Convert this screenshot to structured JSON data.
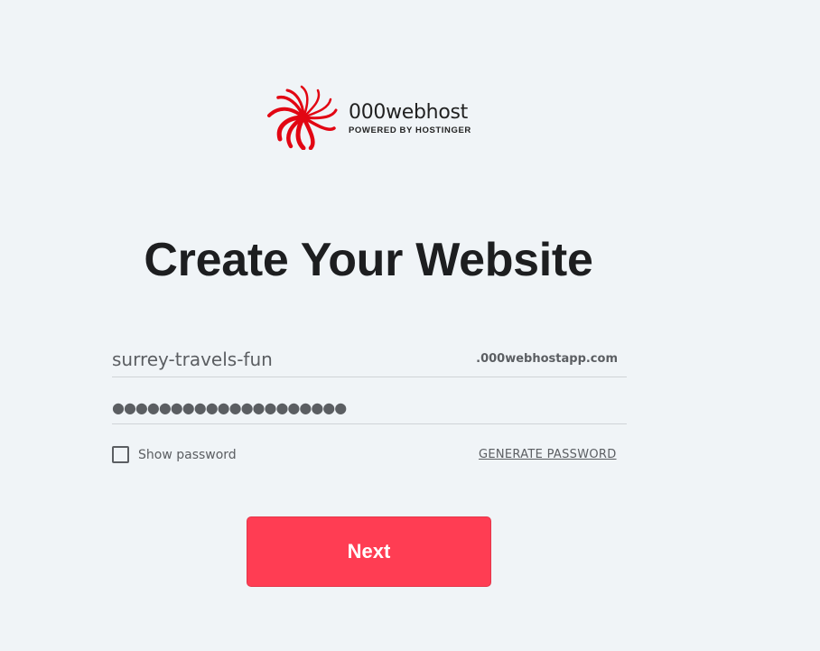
{
  "logo": {
    "name": "000webhost",
    "tagline": "POWERED BY HOSTINGER",
    "icon": "000webhost-swirl-logo",
    "brand_color": "#e20613"
  },
  "heading": "Create Your Website",
  "form": {
    "domain": {
      "value": "surrey-travels-fun",
      "suffix": ".000webhostapp.com"
    },
    "password": {
      "masked_value": "●●●●●●●●●●●●●●●●●●●●"
    },
    "show_password": {
      "label": "Show password",
      "checked": false
    },
    "generate_label": "GENERATE PASSWORD",
    "next_label": "Next"
  },
  "colors": {
    "background": "#f0f4f7",
    "button": "#ff3d53",
    "text": "#1d1e20",
    "muted": "#5b5e62"
  }
}
